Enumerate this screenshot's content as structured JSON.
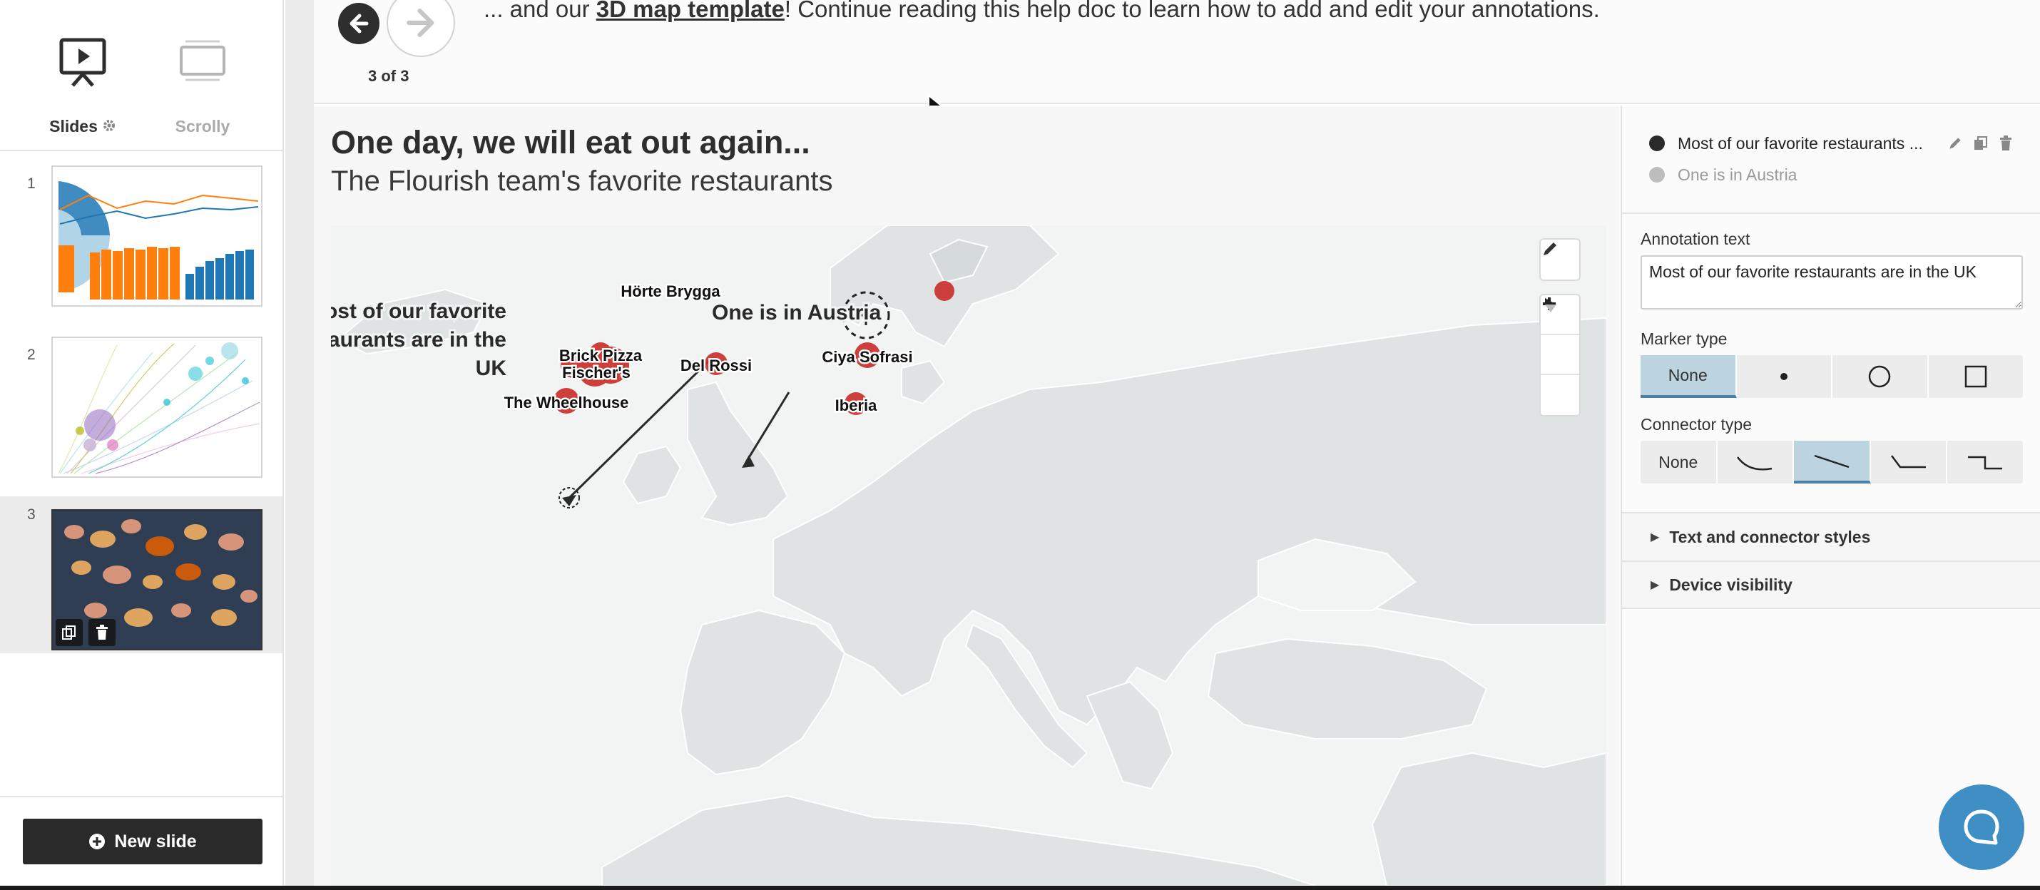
{
  "sidebar": {
    "modes": [
      {
        "label": "Slides",
        "icon": "presentation-icon"
      },
      {
        "label": "Scrolly",
        "icon": "scrolly-icon"
      }
    ],
    "slides": [
      {
        "number": "1"
      },
      {
        "number": "2"
      },
      {
        "number": "3"
      }
    ],
    "new_slide_label": "New slide"
  },
  "header": {
    "slide_counter": "3 of 3",
    "help_prefix": "... and our ",
    "help_link": "3D map template",
    "help_suffix": "! Continue reading this help doc to learn how to add and edit your annotations."
  },
  "viz": {
    "title": "One day, we will eat out again...",
    "subtitle": "The Flourish team's favorite restaurants",
    "restaurants": [
      {
        "name": "Hörte Brygga"
      },
      {
        "name": "Brick Pizza"
      },
      {
        "name": "Fischer's"
      },
      {
        "name": "The Wheelhouse"
      },
      {
        "name": "Del Rossi"
      },
      {
        "name": "Ciya Sofrasi"
      },
      {
        "name": "Iberia"
      }
    ],
    "annotations": {
      "uk_line1": "Most of our favorite",
      "uk_line2": "restaurants are in the",
      "uk_line3": "UK",
      "austria": "One is in Austria"
    },
    "colors": {
      "marker": "#c9302c",
      "land": "#dfe3e3",
      "sea": "#f2f3f3"
    }
  },
  "panel": {
    "annotations": [
      {
        "text": "Most of our favorite restaurants ...",
        "active": true
      },
      {
        "text": "One is in Austria",
        "active": false
      }
    ],
    "annotation_text_label": "Annotation text",
    "annotation_text_value": "Most of our favorite restaurants are in the UK",
    "marker_type_label": "Marker type",
    "marker_options": [
      "None",
      "dot",
      "circle",
      "square"
    ],
    "marker_selected": "None",
    "connector_type_label": "Connector type",
    "connector_options": [
      "None",
      "curve",
      "straight",
      "elbow",
      "step"
    ],
    "connector_selected": "straight",
    "sections": [
      "Text and connector styles",
      "Device visibility"
    ],
    "accent": "#4b7fa6"
  }
}
